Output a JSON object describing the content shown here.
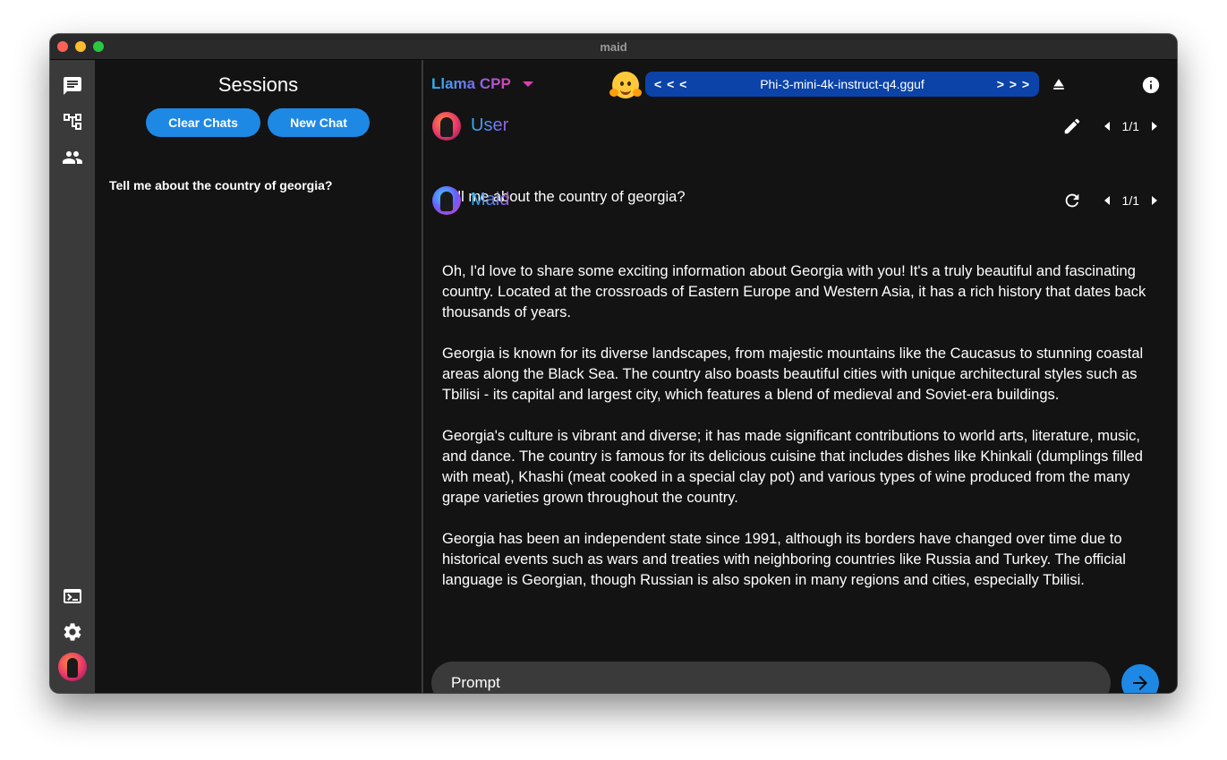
{
  "window": {
    "title": "maid"
  },
  "rail": {
    "icons": [
      "chat-icon",
      "model-tree-icon",
      "people-icon",
      "terminal-icon",
      "gear-icon",
      "avatar"
    ]
  },
  "sessions": {
    "title": "Sessions",
    "clear_label": "Clear Chats",
    "new_label": "New Chat",
    "items": [
      {
        "label": "Tell me about the country of georgia?"
      }
    ]
  },
  "header": {
    "api_name": "Llama CPP",
    "prev_label": "< < <",
    "model_name": "Phi-3-mini-4k-instruct-q4.gguf",
    "next_label": "> > >"
  },
  "messages": [
    {
      "sender": "User",
      "pager": "1/1",
      "paragraphs": [
        "Tell me about the country of georgia?"
      ]
    },
    {
      "sender": "Maid",
      "pager": "1/1",
      "paragraphs": [
        "Oh, I'd love to share some exciting information about Georgia with you! It's a truly beautiful and fascinating country. Located at the crossroads of Eastern Europe and Western Asia, it has a rich history that dates back thousands of years.",
        "Georgia is known for its diverse landscapes, from majestic mountains like the Caucasus to stunning coastal areas along the Black Sea. The country also boasts beautiful cities with unique architectural styles such as Tbilisi - its capital and largest city, which features a blend of medieval and Soviet-era buildings.",
        "Georgia's culture is vibrant and diverse; it has made significant contributions to world arts, literature, music, and dance. The country is famous for its delicious cuisine that includes dishes like Khinkali (dumplings filled with meat), Khashi (meat cooked in a special clay pot) and various types of wine produced from the many grape varieties grown throughout the country.",
        "Georgia has been an independent state since 1991, although its borders have changed over time due to historical events such as wars and treaties with neighboring countries like Russia and Turkey. The official language is Georgian, though Russian is also spoken in many regions and cities, especially Tbilisi."
      ]
    }
  ],
  "prompt": {
    "placeholder": "Prompt",
    "value": ""
  },
  "colors": {
    "accent": "#1e88e5",
    "model_bar": "#0b43a8",
    "background": "#131313",
    "rail": "#3a3a3a"
  }
}
